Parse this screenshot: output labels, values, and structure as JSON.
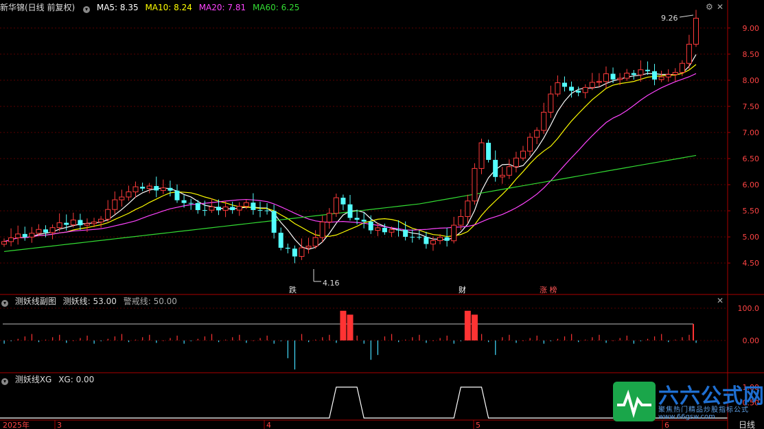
{
  "header": {
    "stock_name": "新华锦(日线 前复权)",
    "ma5": "MA5: 8.35",
    "ma10": "MA10: 8.24",
    "ma20": "MA20: 7.81",
    "ma60": "MA60: 6.25",
    "colors": {
      "ma5": "#ffffff",
      "ma10": "#ffff00",
      "ma20": "#ff44ff",
      "ma60": "#33dd33"
    }
  },
  "sub1": {
    "title": "测妖线副图",
    "line_label": "测妖线: 53.00",
    "warn_label": "警戒线: 50.00"
  },
  "sub2": {
    "title": "测妖线XG",
    "xg_label": "XG: 0.00"
  },
  "markers": {
    "low_label": "4.16",
    "high_label": "9.26",
    "tags": [
      "跌",
      "财",
      "涨 榜"
    ]
  },
  "time_axis": {
    "year": "2025年",
    "months": [
      "3",
      "4",
      "5",
      "6"
    ],
    "period": "日线"
  },
  "watermark": {
    "title": "六六公式网",
    "subtitle": "聚焦热门精品炒股指标公式",
    "url": "www.66gsw.com"
  },
  "chart_data": [
    {
      "type": "candlestick",
      "title": "",
      "y_axis_ticks": [
        "9.00",
        "8.50",
        "8.00",
        "7.50",
        "7.00",
        "6.50",
        "6.00",
        "5.50",
        "5.00",
        "4.50"
      ],
      "ylim": [
        4.2,
        9.3
      ],
      "low": 4.16,
      "high": 9.26,
      "series": [
        {
          "name": "MA5",
          "color": "#ffffff"
        },
        {
          "name": "MA10",
          "color": "#ffff00"
        },
        {
          "name": "MA20",
          "color": "#ff44ff"
        },
        {
          "name": "MA60",
          "color": "#33dd33"
        }
      ]
    },
    {
      "type": "bar",
      "title": "",
      "y_axis_ticks": [
        "100.0",
        "0.00"
      ],
      "ylim": [
        -100,
        100
      ],
      "warn_line": 50
    },
    {
      "type": "line",
      "title": "",
      "y_axis_ticks": [
        "1.00",
        "0.50"
      ],
      "ylim": [
        0,
        1
      ]
    }
  ]
}
